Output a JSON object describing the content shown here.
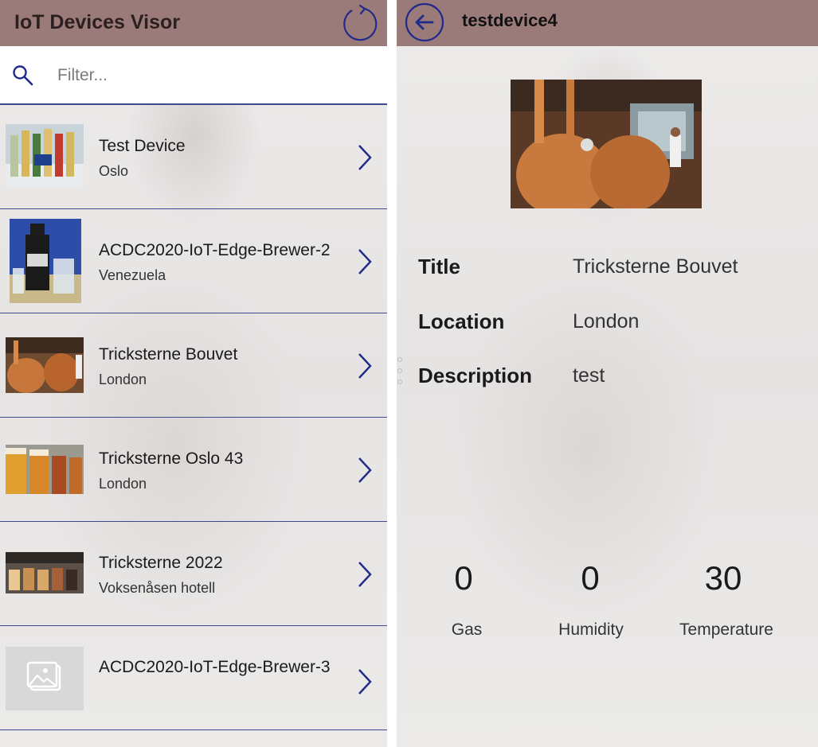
{
  "app": {
    "title": "IoT Devices Visor"
  },
  "search": {
    "placeholder": "Filter..."
  },
  "devices": [
    {
      "title": "Test Device",
      "location": "Oslo",
      "thumb": "beer-bottles"
    },
    {
      "title": "ACDC2020-IoT-Edge-Brewer-2",
      "location": "Venezuela",
      "thumb": "polar-bottle"
    },
    {
      "title": "Tricksterne Bouvet",
      "location": "London",
      "thumb": "brewery-kettles"
    },
    {
      "title": "Tricksterne Oslo 43",
      "location": "London",
      "thumb": "beer-glasses"
    },
    {
      "title": "Tricksterne 2022",
      "location": "Voksenåsen hotell",
      "thumb": "tasting-glasses"
    },
    {
      "title": "ACDC2020-IoT-Edge-Brewer-3",
      "location": "",
      "thumb": "image-placeholder"
    }
  ],
  "detail": {
    "device_name": "testdevice4",
    "fields": {
      "title_label": "Title",
      "title_value": "Tricksterne Bouvet",
      "location_label": "Location",
      "location_value": "London",
      "description_label": "Description",
      "description_value": "test"
    },
    "metrics": {
      "gas_value": "0",
      "gas_label": "Gas",
      "humidity_value": "0",
      "humidity_label": "Humidity",
      "temperature_value": "30",
      "temperature_label": "Temperature"
    }
  },
  "colors": {
    "header": "#9b7b79",
    "accent": "#1f2a8a",
    "divider": "#3b4a8a"
  }
}
